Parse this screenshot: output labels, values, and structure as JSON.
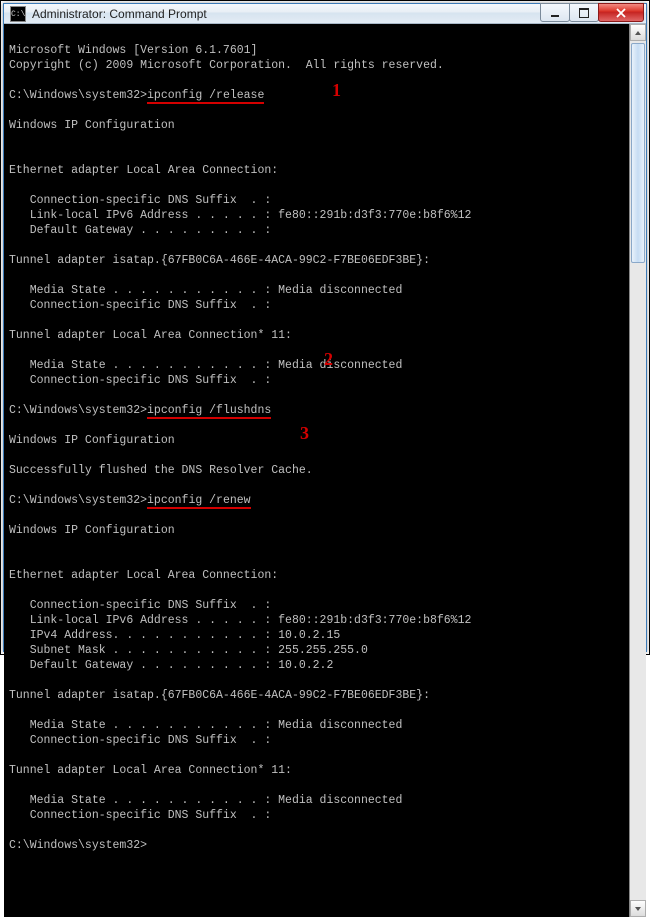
{
  "window": {
    "icon_text": "C:\\",
    "title": "Administrator: Command Prompt"
  },
  "annotations": {
    "a1": "1",
    "a2": "2",
    "a3": "3"
  },
  "cmds": {
    "c1": "ipconfig /release",
    "c2": "ipconfig /flushdns",
    "c3": "ipconfig /renew"
  },
  "lines": {
    "l1": "Microsoft Windows [Version 6.1.7601]",
    "l2": "Copyright (c) 2009 Microsoft Corporation.  All rights reserved.",
    "l3": "",
    "l4p": "C:\\Windows\\system32>",
    "l5": "",
    "l6": "Windows IP Configuration",
    "l7": "",
    "l8": "",
    "l9": "Ethernet adapter Local Area Connection:",
    "l10": "",
    "l11": "   Connection-specific DNS Suffix  . :",
    "l12": "   Link-local IPv6 Address . . . . . : fe80::291b:d3f3:770e:b8f6%12",
    "l13": "   Default Gateway . . . . . . . . . :",
    "l14": "",
    "l15": "Tunnel adapter isatap.{67FB0C6A-466E-4ACA-99C2-F7BE06EDF3BE}:",
    "l16": "",
    "l17": "   Media State . . . . . . . . . . . : Media disconnected",
    "l18": "   Connection-specific DNS Suffix  . :",
    "l19": "",
    "l20": "Tunnel adapter Local Area Connection* 11:",
    "l21": "",
    "l22": "   Media State . . . . . . . . . . . : Media disconnected",
    "l23": "   Connection-specific DNS Suffix  . :",
    "l24": "",
    "l25p": "C:\\Windows\\system32>",
    "l26": "",
    "l27": "Windows IP Configuration",
    "l28": "",
    "l29": "Successfully flushed the DNS Resolver Cache.",
    "l30": "",
    "l31p": "C:\\Windows\\system32>",
    "l32": "",
    "l33": "Windows IP Configuration",
    "l34": "",
    "l35": "",
    "l36": "Ethernet adapter Local Area Connection:",
    "l37": "",
    "l38": "   Connection-specific DNS Suffix  . :",
    "l39": "   Link-local IPv6 Address . . . . . : fe80::291b:d3f3:770e:b8f6%12",
    "l40": "   IPv4 Address. . . . . . . . . . . : 10.0.2.15",
    "l41": "   Subnet Mask . . . . . . . . . . . : 255.255.255.0",
    "l42": "   Default Gateway . . . . . . . . . : 10.0.2.2",
    "l43": "",
    "l44": "Tunnel adapter isatap.{67FB0C6A-466E-4ACA-99C2-F7BE06EDF3BE}:",
    "l45": "",
    "l46": "   Media State . . . . . . . . . . . : Media disconnected",
    "l47": "   Connection-specific DNS Suffix  . :",
    "l48": "",
    "l49": "Tunnel adapter Local Area Connection* 11:",
    "l50": "",
    "l51": "   Media State . . . . . . . . . . . : Media disconnected",
    "l52": "   Connection-specific DNS Suffix  . :",
    "l53": "",
    "l54": "C:\\Windows\\system32>"
  }
}
